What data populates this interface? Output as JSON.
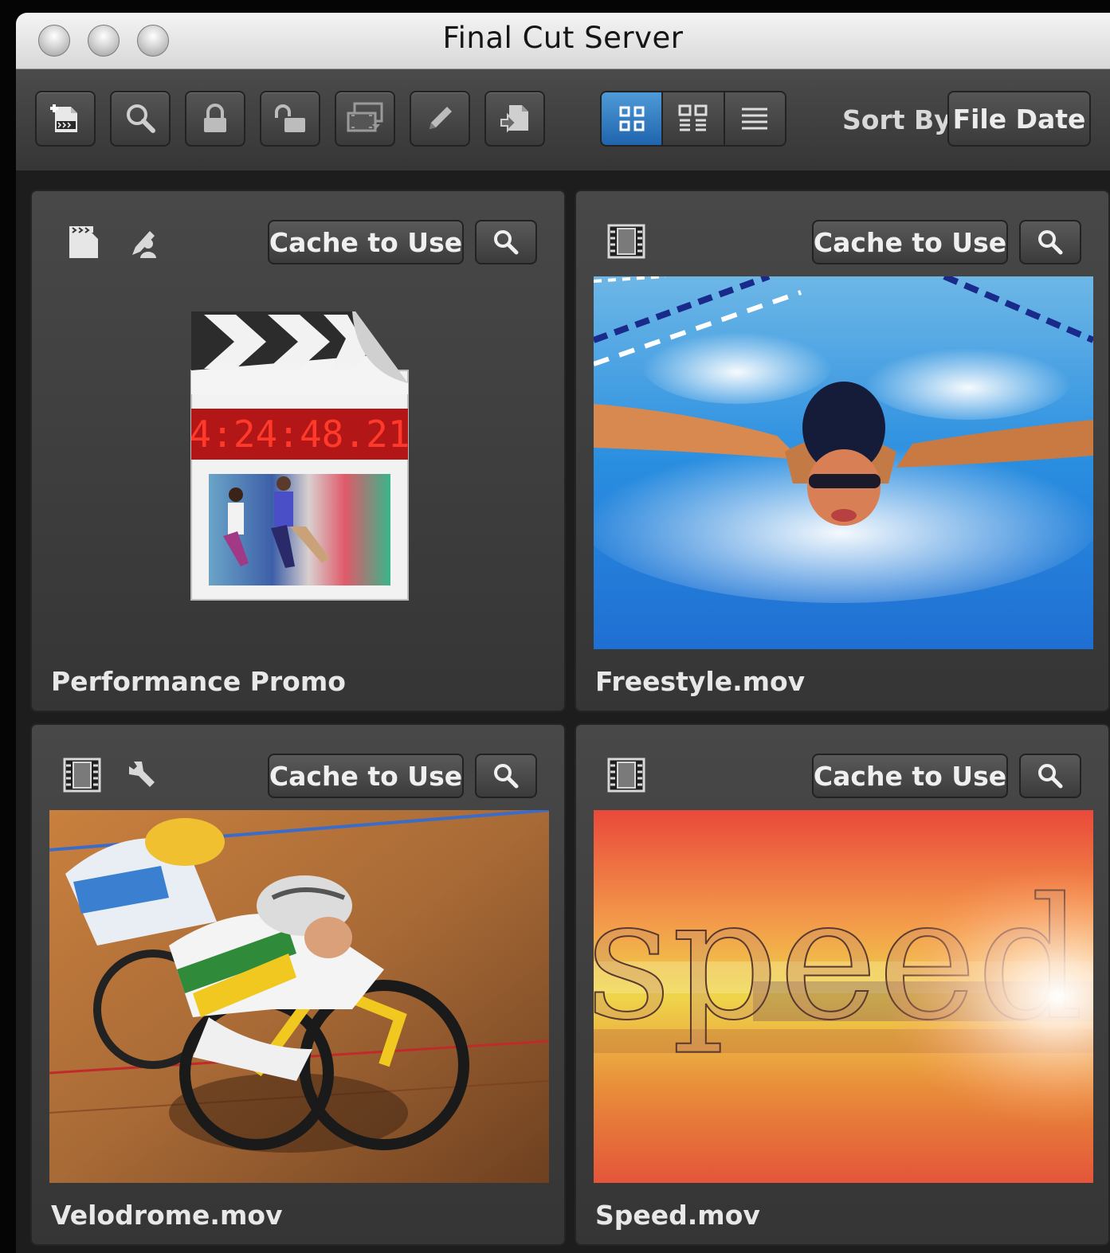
{
  "window": {
    "title": "Final Cut Server"
  },
  "toolbar": {
    "buttons": [
      {
        "icon": "add-asset-icon"
      },
      {
        "icon": "search-icon"
      },
      {
        "icon": "lock-icon"
      },
      {
        "icon": "unlock-icon"
      },
      {
        "icon": "media-transfer-icon"
      },
      {
        "icon": "pencil-icon"
      },
      {
        "icon": "download-icon"
      }
    ],
    "views": [
      {
        "icon": "thumbnail-view-icon",
        "active": true
      },
      {
        "icon": "detail-thumbnail-view-icon",
        "active": false
      },
      {
        "icon": "list-view-icon",
        "active": false
      }
    ],
    "sort_label": "Sort By",
    "sort_value": "File Date"
  },
  "assets": [
    {
      "name": "Performance Promo",
      "cache_label": "Cache to Use",
      "type_icon": "project-clapper-icon",
      "extra_icon": "annotation-icon",
      "thumbnail": "project-icon"
    },
    {
      "name": "Freestyle.mov",
      "cache_label": "Cache to Use",
      "type_icon": "film-strip-icon",
      "thumbnail": "swimmer-photo"
    },
    {
      "name": "Velodrome.mov",
      "cache_label": "Cache to Use",
      "type_icon": "film-strip-icon",
      "extra_icon": "tool-icon",
      "thumbnail": "cyclist-photo"
    },
    {
      "name": "Speed.mov",
      "cache_label": "Cache to Use",
      "type_icon": "film-strip-icon",
      "thumbnail": "speed-graphic"
    }
  ],
  "project_timecode": "4:24:48.21",
  "speed_graphic_text": "speed",
  "colors": {
    "active_blue": "#2a72bd",
    "toolbar": "#404040",
    "card": "#414141"
  }
}
